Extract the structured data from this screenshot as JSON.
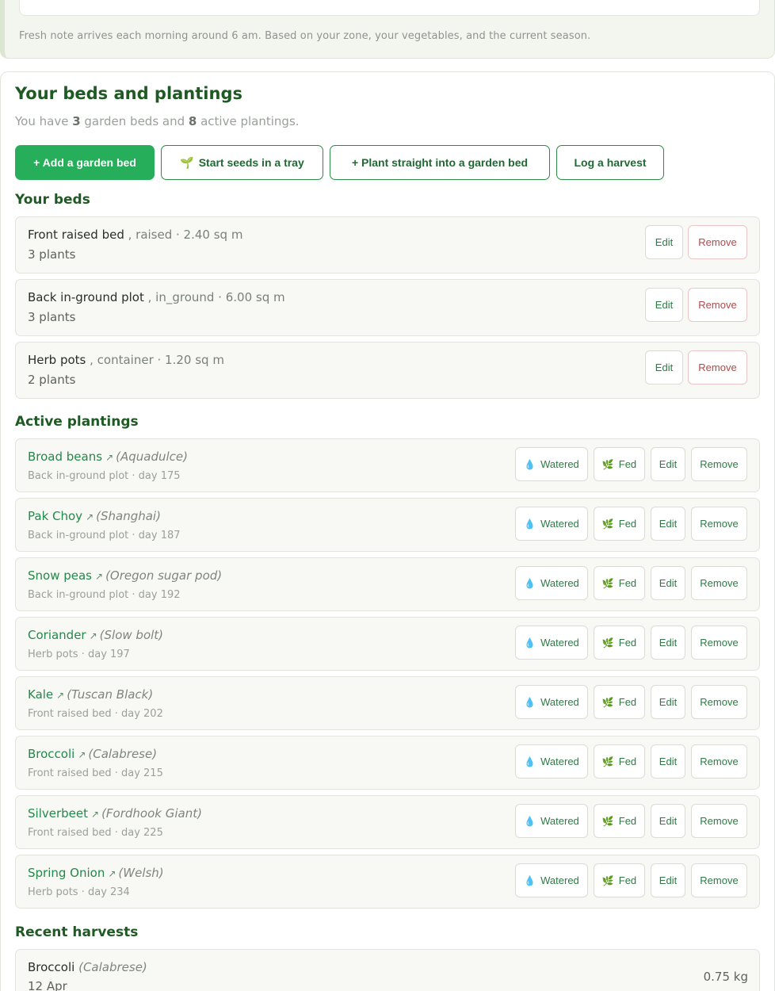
{
  "note": {
    "footer": "Fresh note arrives each morning around 6 am. Based on your zone, your vegetables, and the current season."
  },
  "beds_section": {
    "title": "Your beds and plantings",
    "summary_pre": "You have ",
    "bed_count": "3",
    "summary_mid": " garden beds and ",
    "planting_count": "8",
    "summary_post": " active plantings."
  },
  "actions": {
    "add_bed": "+ Add a garden bed",
    "start_seeds": "Start seeds in a tray",
    "plant_straight": "+ Plant straight into a garden bed",
    "log_harvest": "Log a harvest"
  },
  "beds_heading": "Your beds",
  "beds": [
    {
      "name": "Front raised bed",
      "meta": " , raised · 2.40 sq m",
      "count": "3 plants"
    },
    {
      "name": "Back in-ground plot",
      "meta": " , in_ground · 6.00 sq m",
      "count": "3 plants"
    },
    {
      "name": "Herb pots",
      "meta": " , container · 1.20 sq m",
      "count": "2 plants"
    }
  ],
  "bed_buttons": {
    "edit": "Edit",
    "remove": "Remove"
  },
  "plantings_heading": "Active plantings",
  "plantings": [
    {
      "name": "Broad beans",
      "variety": "(Aquadulce)",
      "sub": "Back in-ground plot · day 175"
    },
    {
      "name": "Pak Choy",
      "variety": "(Shanghai)",
      "sub": "Back in-ground plot · day 187"
    },
    {
      "name": "Snow peas",
      "variety": "(Oregon sugar pod)",
      "sub": "Back in-ground plot · day 192"
    },
    {
      "name": "Coriander",
      "variety": "(Slow bolt)",
      "sub": "Herb pots · day 197"
    },
    {
      "name": "Kale",
      "variety": "(Tuscan Black)",
      "sub": "Front raised bed · day 202"
    },
    {
      "name": "Broccoli",
      "variety": "(Calabrese)",
      "sub": "Front raised bed · day 215"
    },
    {
      "name": "Silverbeet",
      "variety": "(Fordhook Giant)",
      "sub": "Front raised bed · day 225"
    },
    {
      "name": "Spring Onion",
      "variety": "(Welsh)",
      "sub": "Herb pots · day 234"
    }
  ],
  "planting_buttons": {
    "watered": "Watered",
    "fed": "Fed",
    "edit": "Edit",
    "remove": "Remove"
  },
  "harvests_heading": "Recent harvests",
  "harvests": [
    {
      "name": "Broccoli",
      "variety": "(Calabrese)",
      "date": "12 Apr",
      "qty": "0.75 kg"
    }
  ],
  "icons": {
    "seedling": "seedling-icon",
    "water": "water-drop-icon",
    "fertilizer": "leaf-icon",
    "link": "arrow-up-right-icon"
  }
}
